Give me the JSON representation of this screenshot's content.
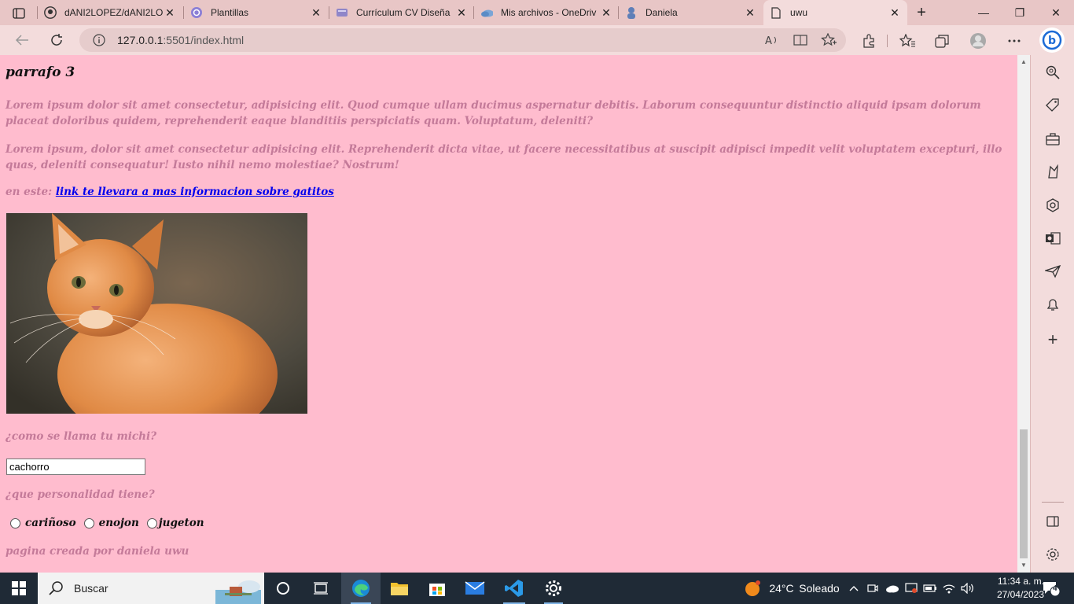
{
  "browser": {
    "tabs": [
      {
        "title": "dANI2LOPEZ/dANI2LO",
        "icon": "github-icon"
      },
      {
        "title": "Plantillas",
        "icon": "canva-icon"
      },
      {
        "title": "Currículum CV Diseña",
        "icon": "document-icon"
      },
      {
        "title": "Mis archivos - OneDriv",
        "icon": "onedrive-icon"
      },
      {
        "title": "Daniela",
        "icon": "profile-icon"
      },
      {
        "title": "uwu",
        "icon": "page-icon",
        "active": true
      }
    ],
    "url_host": "127.0.0.1",
    "url_rest": ":5501/index.html"
  },
  "page": {
    "heading": "parrafo 3",
    "paragraph1": "Lorem ipsum dolor sit amet consectetur, adipisicing elit. Quod cumque ullam ducimus aspernatur debitis. Laborum consequuntur distinctio aliquid ipsam dolorum placeat doloribus quidem, reprehenderit eaque blanditiis perspiciatis quam. Voluptatum, deleniti?",
    "paragraph2": "Lorem ipsum, dolor sit amet consectetur adipisicing elit. Reprehenderit dicta vitae, ut facere necessitatibus at suscipit adipisci impedit velit voluptatem excepturi, illo quas, deleniti consequatur! Iusto nihil nemo molestiae? Nostrum!",
    "link_prefix": "en este: ",
    "link_text": "link te llevara a mas informacion sobre gatitos",
    "question_name": "¿como se llama tu michi?",
    "name_value": "cachorro",
    "question_personality": "¿que personalidad tiene?",
    "options": [
      "cariñoso",
      "enojon",
      "jugeton"
    ],
    "footer": "pagina creada por daniela uwu"
  },
  "taskbar": {
    "search_placeholder": "Buscar",
    "weather_temp": "24°C",
    "weather_desc": "Soleado",
    "time": "11:34 a. m.",
    "date": "27/04/2023",
    "notifications": "4"
  },
  "colors": {
    "page_background": "#ffbcce",
    "text_pink": "#c47a99",
    "link_blue": "#0000ee",
    "browser_chrome": "#f3dcdc"
  }
}
